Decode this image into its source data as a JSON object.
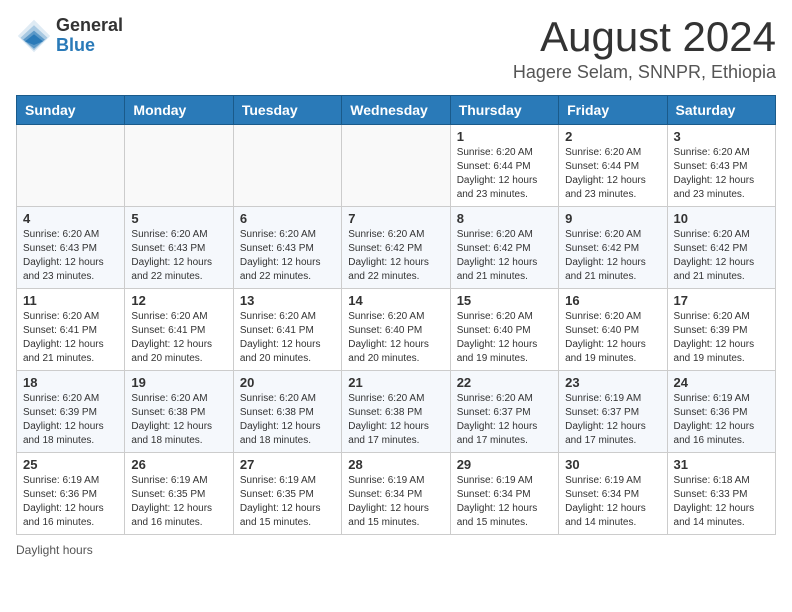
{
  "header": {
    "logo_general": "General",
    "logo_blue": "Blue",
    "month_title": "August 2024",
    "location": "Hagere Selam, SNNPR, Ethiopia"
  },
  "weekdays": [
    "Sunday",
    "Monday",
    "Tuesday",
    "Wednesday",
    "Thursday",
    "Friday",
    "Saturday"
  ],
  "footer": {
    "daylight_label": "Daylight hours"
  },
  "weeks": [
    [
      {
        "day": "",
        "info": ""
      },
      {
        "day": "",
        "info": ""
      },
      {
        "day": "",
        "info": ""
      },
      {
        "day": "",
        "info": ""
      },
      {
        "day": "1",
        "info": "Sunrise: 6:20 AM\nSunset: 6:44 PM\nDaylight: 12 hours\nand 23 minutes."
      },
      {
        "day": "2",
        "info": "Sunrise: 6:20 AM\nSunset: 6:44 PM\nDaylight: 12 hours\nand 23 minutes."
      },
      {
        "day": "3",
        "info": "Sunrise: 6:20 AM\nSunset: 6:43 PM\nDaylight: 12 hours\nand 23 minutes."
      }
    ],
    [
      {
        "day": "4",
        "info": "Sunrise: 6:20 AM\nSunset: 6:43 PM\nDaylight: 12 hours\nand 23 minutes."
      },
      {
        "day": "5",
        "info": "Sunrise: 6:20 AM\nSunset: 6:43 PM\nDaylight: 12 hours\nand 22 minutes."
      },
      {
        "day": "6",
        "info": "Sunrise: 6:20 AM\nSunset: 6:43 PM\nDaylight: 12 hours\nand 22 minutes."
      },
      {
        "day": "7",
        "info": "Sunrise: 6:20 AM\nSunset: 6:42 PM\nDaylight: 12 hours\nand 22 minutes."
      },
      {
        "day": "8",
        "info": "Sunrise: 6:20 AM\nSunset: 6:42 PM\nDaylight: 12 hours\nand 21 minutes."
      },
      {
        "day": "9",
        "info": "Sunrise: 6:20 AM\nSunset: 6:42 PM\nDaylight: 12 hours\nand 21 minutes."
      },
      {
        "day": "10",
        "info": "Sunrise: 6:20 AM\nSunset: 6:42 PM\nDaylight: 12 hours\nand 21 minutes."
      }
    ],
    [
      {
        "day": "11",
        "info": "Sunrise: 6:20 AM\nSunset: 6:41 PM\nDaylight: 12 hours\nand 21 minutes."
      },
      {
        "day": "12",
        "info": "Sunrise: 6:20 AM\nSunset: 6:41 PM\nDaylight: 12 hours\nand 20 minutes."
      },
      {
        "day": "13",
        "info": "Sunrise: 6:20 AM\nSunset: 6:41 PM\nDaylight: 12 hours\nand 20 minutes."
      },
      {
        "day": "14",
        "info": "Sunrise: 6:20 AM\nSunset: 6:40 PM\nDaylight: 12 hours\nand 20 minutes."
      },
      {
        "day": "15",
        "info": "Sunrise: 6:20 AM\nSunset: 6:40 PM\nDaylight: 12 hours\nand 19 minutes."
      },
      {
        "day": "16",
        "info": "Sunrise: 6:20 AM\nSunset: 6:40 PM\nDaylight: 12 hours\nand 19 minutes."
      },
      {
        "day": "17",
        "info": "Sunrise: 6:20 AM\nSunset: 6:39 PM\nDaylight: 12 hours\nand 19 minutes."
      }
    ],
    [
      {
        "day": "18",
        "info": "Sunrise: 6:20 AM\nSunset: 6:39 PM\nDaylight: 12 hours\nand 18 minutes."
      },
      {
        "day": "19",
        "info": "Sunrise: 6:20 AM\nSunset: 6:38 PM\nDaylight: 12 hours\nand 18 minutes."
      },
      {
        "day": "20",
        "info": "Sunrise: 6:20 AM\nSunset: 6:38 PM\nDaylight: 12 hours\nand 18 minutes."
      },
      {
        "day": "21",
        "info": "Sunrise: 6:20 AM\nSunset: 6:38 PM\nDaylight: 12 hours\nand 17 minutes."
      },
      {
        "day": "22",
        "info": "Sunrise: 6:20 AM\nSunset: 6:37 PM\nDaylight: 12 hours\nand 17 minutes."
      },
      {
        "day": "23",
        "info": "Sunrise: 6:19 AM\nSunset: 6:37 PM\nDaylight: 12 hours\nand 17 minutes."
      },
      {
        "day": "24",
        "info": "Sunrise: 6:19 AM\nSunset: 6:36 PM\nDaylight: 12 hours\nand 16 minutes."
      }
    ],
    [
      {
        "day": "25",
        "info": "Sunrise: 6:19 AM\nSunset: 6:36 PM\nDaylight: 12 hours\nand 16 minutes."
      },
      {
        "day": "26",
        "info": "Sunrise: 6:19 AM\nSunset: 6:35 PM\nDaylight: 12 hours\nand 16 minutes."
      },
      {
        "day": "27",
        "info": "Sunrise: 6:19 AM\nSunset: 6:35 PM\nDaylight: 12 hours\nand 15 minutes."
      },
      {
        "day": "28",
        "info": "Sunrise: 6:19 AM\nSunset: 6:34 PM\nDaylight: 12 hours\nand 15 minutes."
      },
      {
        "day": "29",
        "info": "Sunrise: 6:19 AM\nSunset: 6:34 PM\nDaylight: 12 hours\nand 15 minutes."
      },
      {
        "day": "30",
        "info": "Sunrise: 6:19 AM\nSunset: 6:34 PM\nDaylight: 12 hours\nand 14 minutes."
      },
      {
        "day": "31",
        "info": "Sunrise: 6:18 AM\nSunset: 6:33 PM\nDaylight: 12 hours\nand 14 minutes."
      }
    ]
  ]
}
